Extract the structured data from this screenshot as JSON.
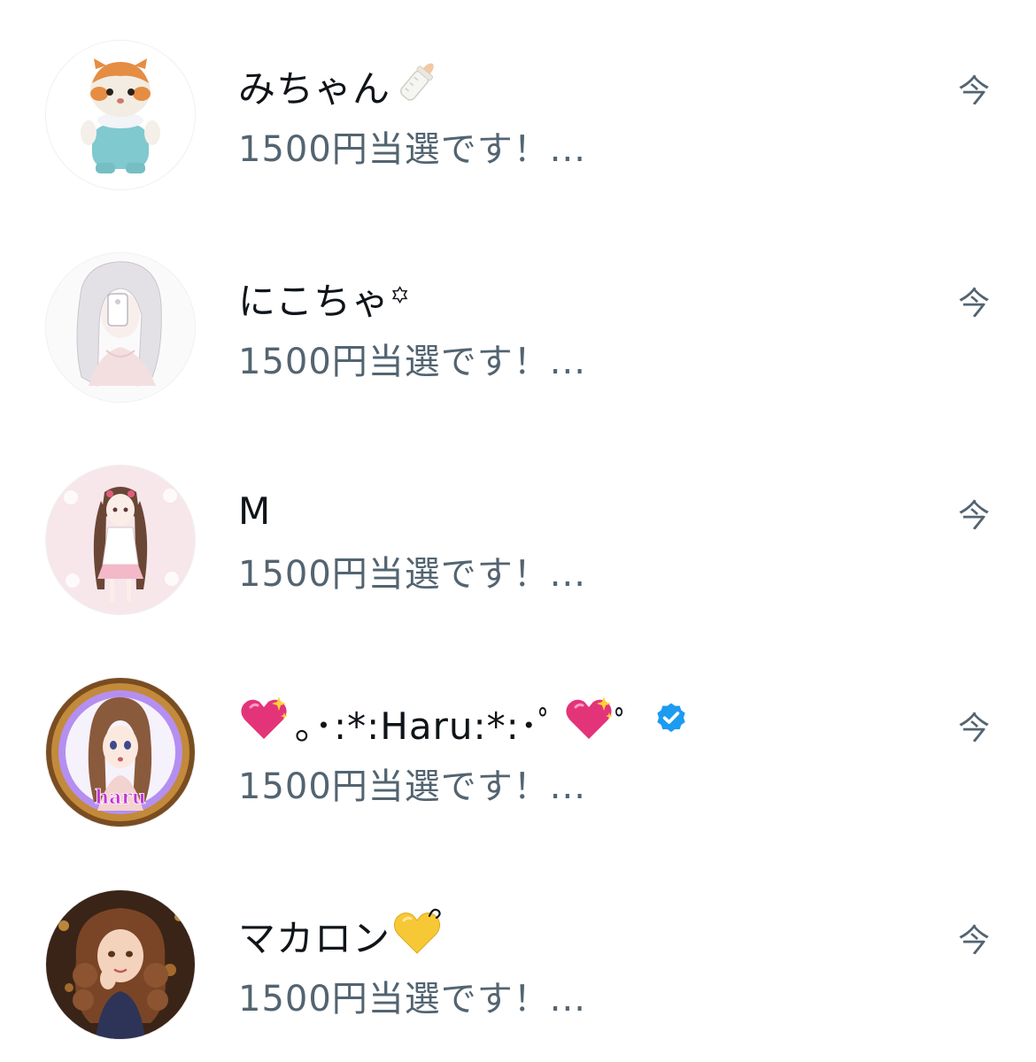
{
  "conversations": [
    {
      "name": "みちゃん",
      "name_emoji": "baby-bottle-icon",
      "preview": "1500円当選です！...",
      "time": "今",
      "avatar": "kitten-figure-avatar"
    },
    {
      "name": "にこちゃ꙳",
      "preview": "1500円当選です！...",
      "time": "今",
      "avatar": "anime-girl-sketch-avatar"
    },
    {
      "name": "M",
      "preview": "1500円当選です！...",
      "time": "今",
      "avatar": "twintail-girl-avatar"
    },
    {
      "name_prefix_emoji": "sparkling-heart-icon",
      "name": "｡･:*:Haru:*:･ﾟ",
      "name_suffix_emoji": "sparkling-heart-icon",
      "name_suffix_text": "ﾟ",
      "verified": true,
      "preview": "1500円当選です！...",
      "time": "今",
      "avatar": "haru-anime-avatar",
      "avatar_text": "haru"
    },
    {
      "name": "マカロン",
      "name_emoji": "yellow-heart-icon",
      "preview": "1500円当選です！...",
      "time": "今",
      "avatar": "curly-hair-woman-avatar"
    }
  ],
  "colors": {
    "name": "#0f1419",
    "secondary": "#536471",
    "verified_badge": "#1d9bf0"
  }
}
